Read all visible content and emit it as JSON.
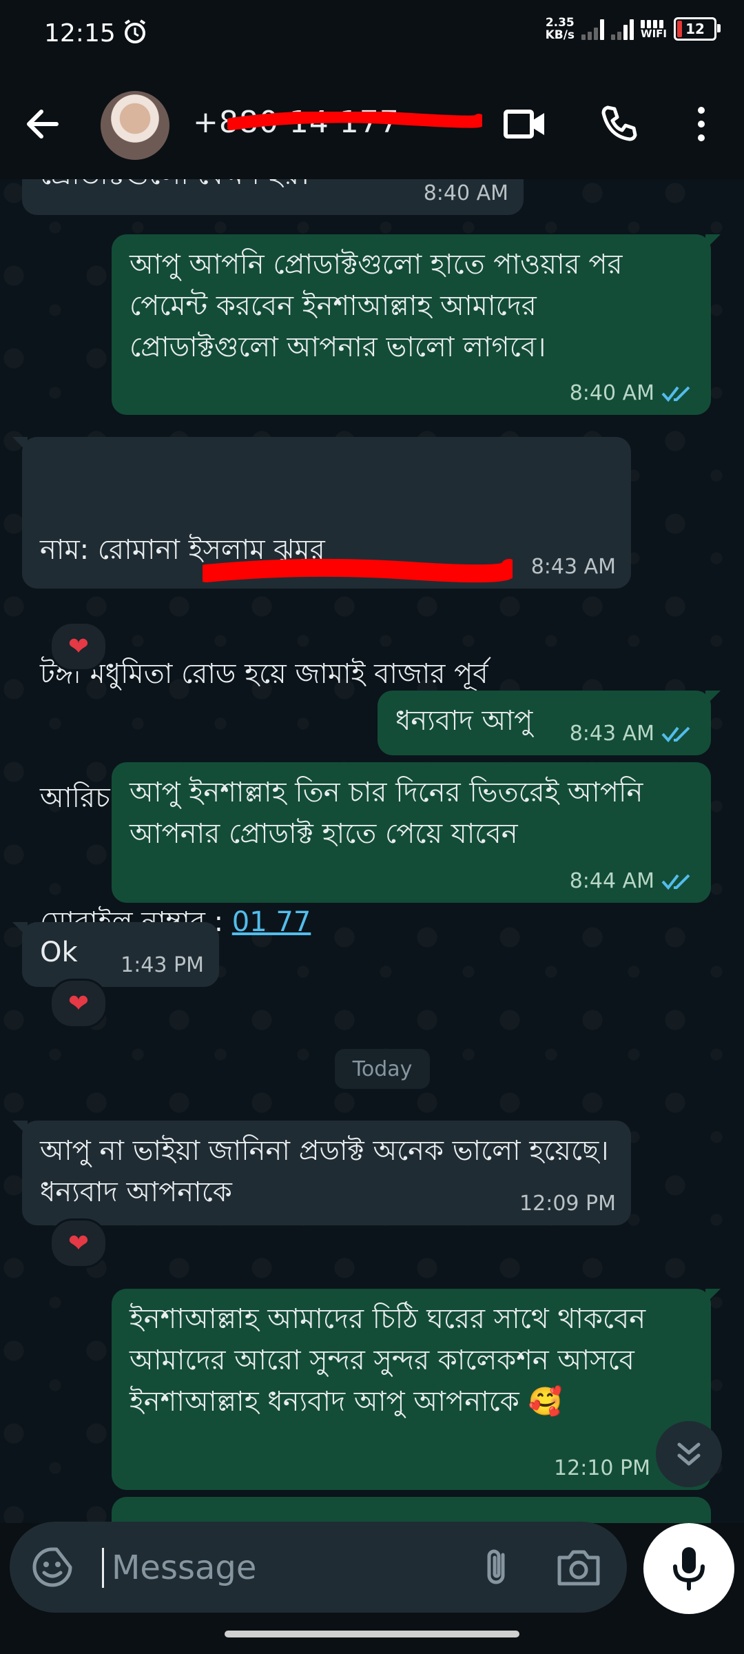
{
  "status_bar": {
    "time": "12:15",
    "net_speed_value": "2.35",
    "net_speed_unit": "KB/s",
    "wifi_label": "WIFI",
    "battery": "12",
    "battery_color": "#e53935",
    "alarm_icon": "alarm-icon"
  },
  "header": {
    "contact": "+880 14 177",
    "icons": [
      "back-arrow-icon",
      "video-call-icon",
      "phone-call-icon",
      "more-vert-icon"
    ]
  },
  "messages": [
    {
      "dir": "in",
      "text": "প্রোডাক্টগুলো কেমন হয়।",
      "time": "8:40 AM"
    },
    {
      "dir": "out",
      "text": "আপু আপনি প্রোডাক্টগুলো হাতে পাওয়ার পর পেমেন্ট করবেন ইনশাআল্লাহ আমাদের প্রোডাক্টগুলো আপনার ভালো লাগবে।",
      "time": "8:40 AM"
    },
    {
      "dir": "in",
      "line1": "নাম: রোমানা ইসলাম ঝুমুর",
      "line2": "টঙ্গী মধুমিতা রোড হয়ে জামাই বাজার পূর্ব",
      "line3": "আরিচ পুর।",
      "line4_label": "মোবাইল নাম্বার : ",
      "line4_link": "01 77",
      "time": "8:43 AM",
      "reaction": "❤"
    },
    {
      "dir": "out",
      "text": "ধন্যবাদ আপু",
      "time": "8:43 AM"
    },
    {
      "dir": "out",
      "text": "আপু ইনশাল্লাহ তিন চার দিনের ভিতরেই আপনি আপনার প্রোডাক্ট হাতে পেয়ে যাবেন",
      "time": "8:44 AM"
    },
    {
      "dir": "in",
      "text": "Ok",
      "time": "1:43 PM",
      "reaction": "❤"
    },
    {
      "dir": "in",
      "text": "আপু না ভাইয়া জানিনা প্রডাক্ট অনেক ভালো হয়েছে। ধন্যবাদ আপনাকে",
      "time": "12:09 PM",
      "reaction": "❤"
    },
    {
      "dir": "out",
      "text": "ইনশাআল্লাহ আমাদের চিঠি ঘরের সাথে থাকবেন আমাদের আরো সুন্দর সুন্দর কালেকশন আসবে ইনশাআল্লাহ ধন্যবাদ আপু আপনাকে",
      "emoji": "🥰",
      "time": "12:10 PM"
    }
  ],
  "date_chip": "Today",
  "composer": {
    "placeholder": "Message",
    "icons": [
      "sticker-icon",
      "attach-icon",
      "camera-icon",
      "mic-icon"
    ]
  },
  "colors": {
    "bg": "#0b141a",
    "incoming": "#202c33",
    "outgoing": "#134d37",
    "read_ticks": "#53bdeb",
    "heart": "#e53945"
  }
}
